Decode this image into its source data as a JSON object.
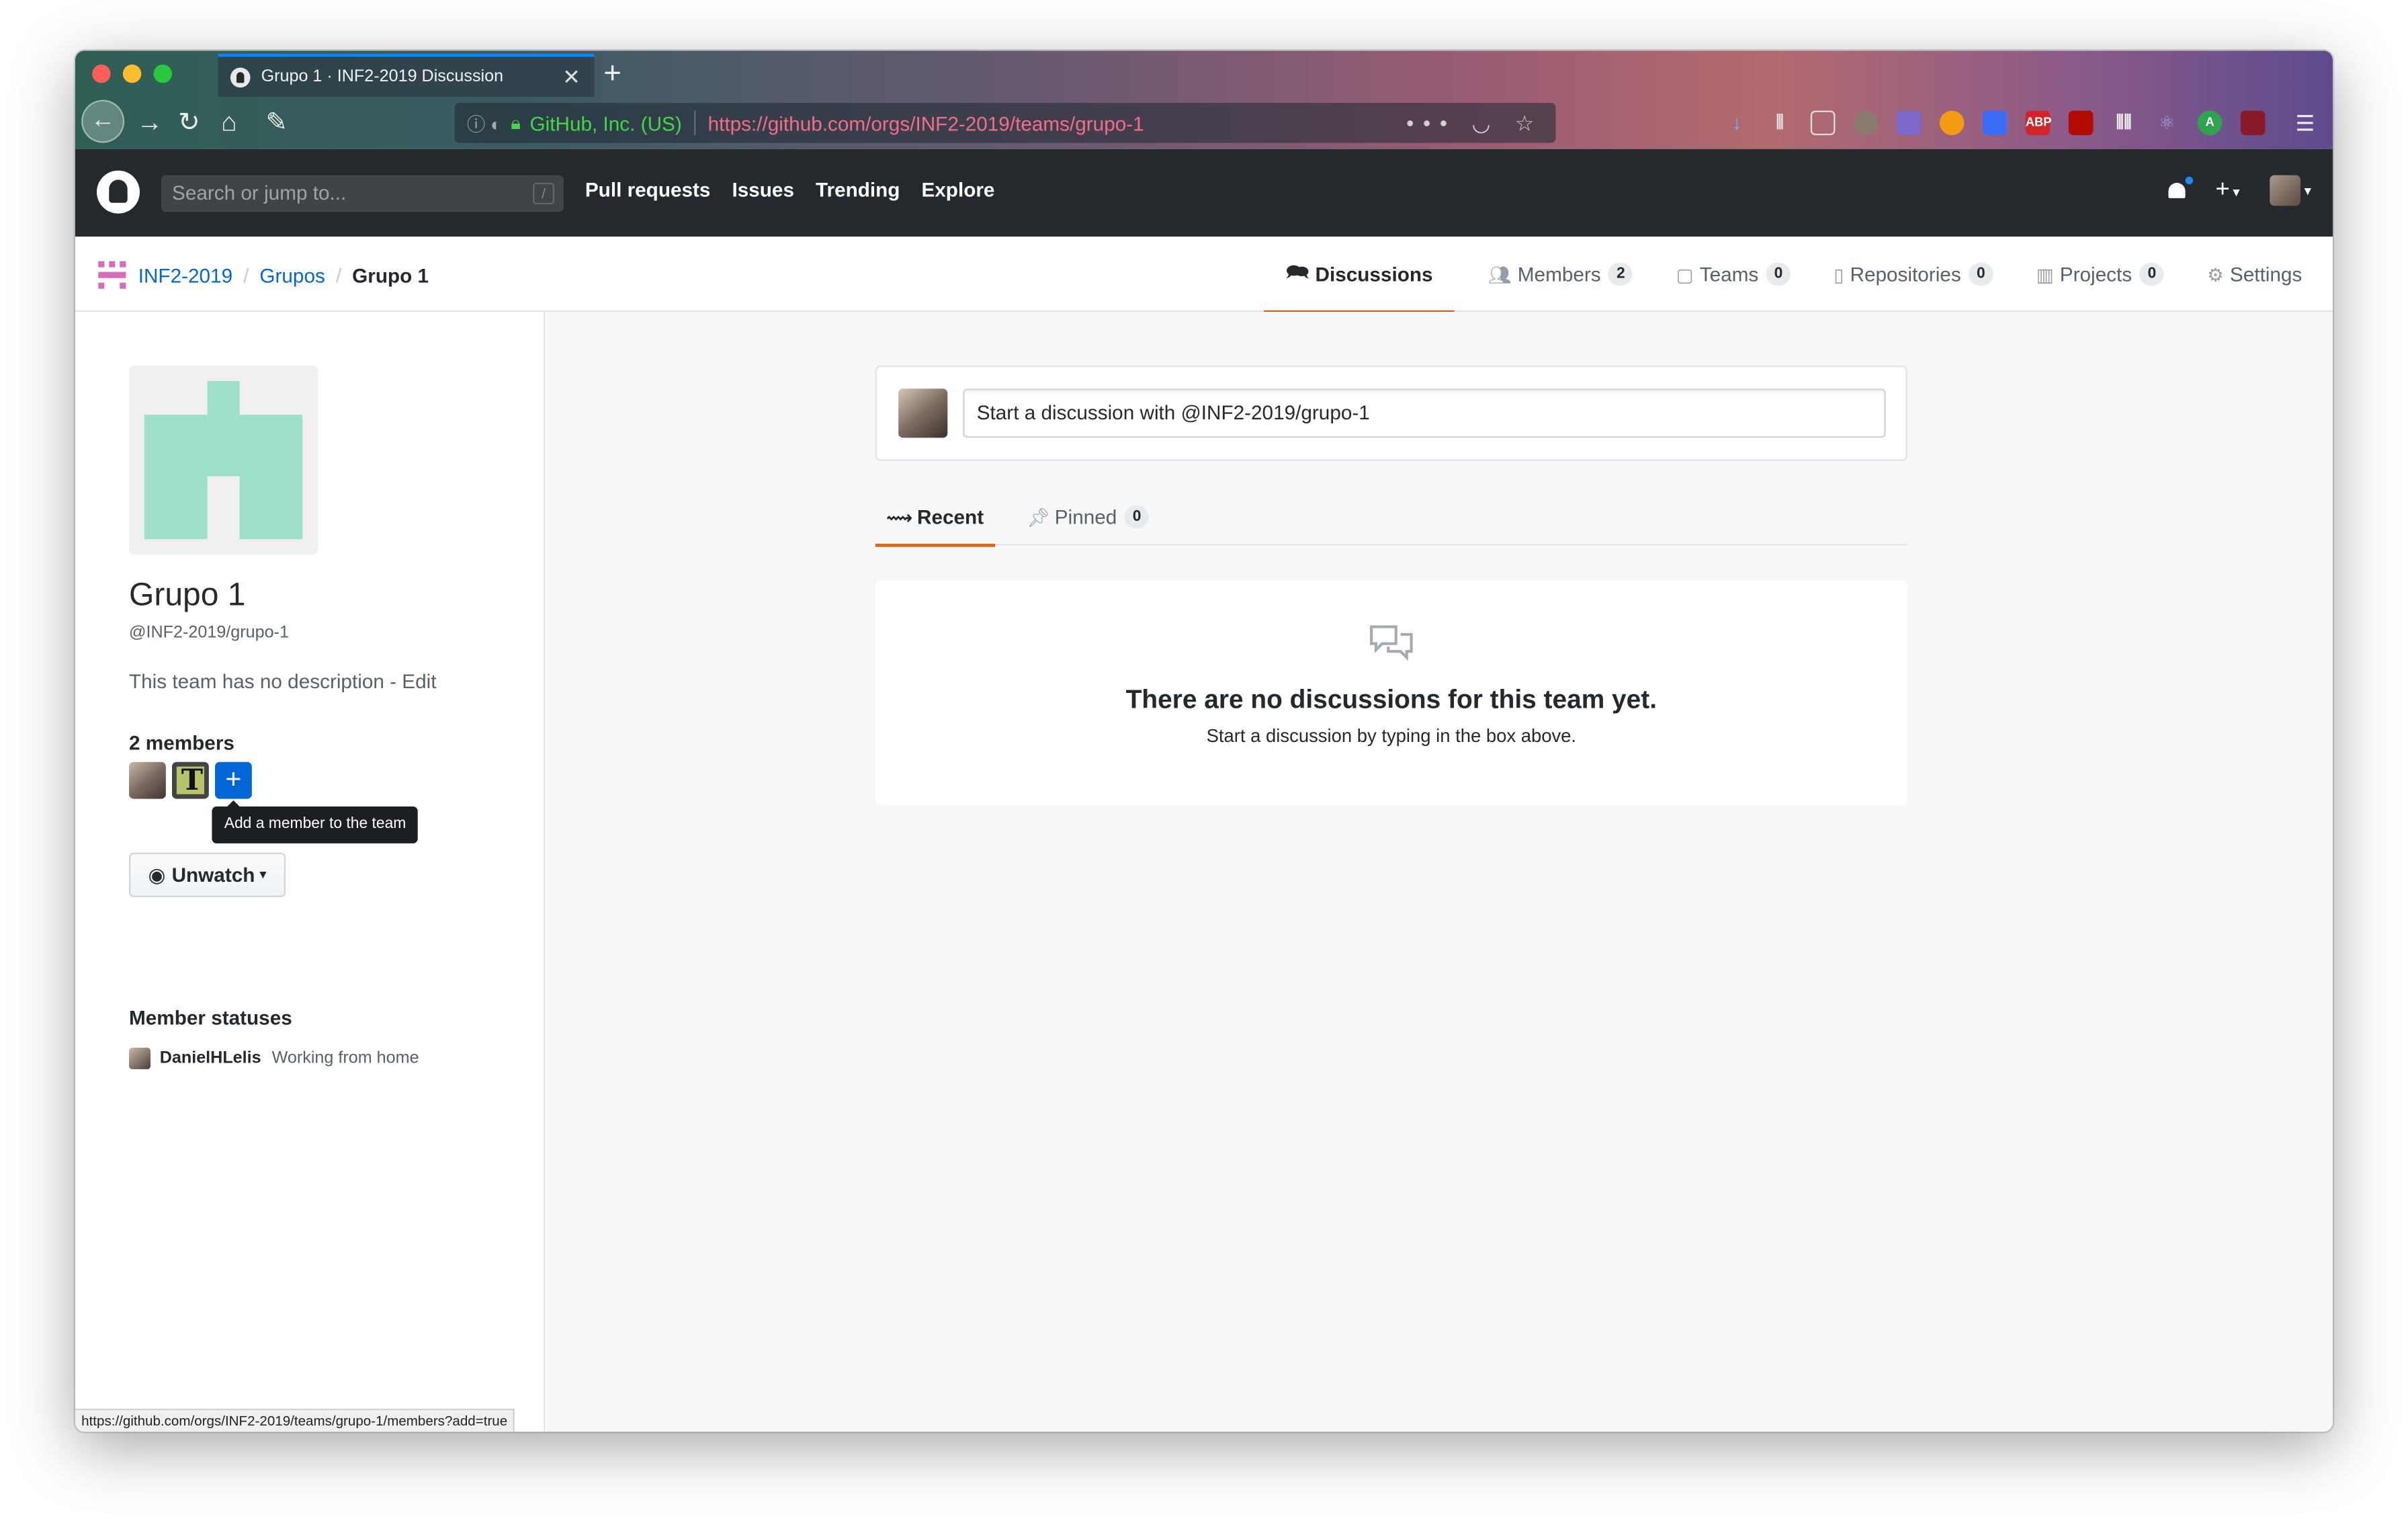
{
  "browser": {
    "tab_title": "Grupo 1 · INF2-2019 Discussion",
    "identity": "GitHub, Inc. (US)",
    "url": "https://github.com/orgs/INF2-2019/teams/grupo-1",
    "page_actions": "•••",
    "status_url": "https://github.com/orgs/INF2-2019/teams/grupo-1/members?add=true"
  },
  "github_header": {
    "search_placeholder": "Search or jump to...",
    "search_hotkey": "/",
    "nav": [
      "Pull requests",
      "Issues",
      "Trending",
      "Explore"
    ]
  },
  "breadcrumb": {
    "org": "INF2-2019",
    "parent": "Grupos",
    "current": "Grupo 1",
    "separator": "/"
  },
  "team_tabs": [
    {
      "label": "Discussions",
      "icon": "comment-discussion-icon",
      "count": null,
      "selected": true
    },
    {
      "label": "Members",
      "icon": "people-icon",
      "count": "2"
    },
    {
      "label": "Teams",
      "icon": "jersey-icon",
      "count": "0"
    },
    {
      "label": "Repositories",
      "icon": "repo-icon",
      "count": "0"
    },
    {
      "label": "Projects",
      "icon": "project-icon",
      "count": "0"
    },
    {
      "label": "Settings",
      "icon": "gear-icon",
      "count": null
    }
  ],
  "sidebar": {
    "team_name": "Grupo 1",
    "team_slug": "@INF2-2019/grupo-1",
    "description": "This team has no description - Edit",
    "members_count": "2 members",
    "add_member_tooltip": "Add a member to the team",
    "unwatch_label": "Unwatch",
    "statuses_heading": "Member statuses",
    "status": {
      "user": "DanielHLelis",
      "message": "Working from home"
    }
  },
  "main": {
    "composer_placeholder": "Start a discussion with @INF2-2019/grupo-1",
    "tabs": [
      {
        "label": "Recent",
        "icon": "pulse-icon",
        "selected": true
      },
      {
        "label": "Pinned",
        "icon": "pin-icon",
        "count": "0"
      }
    ],
    "blankslate_title": "There are no discussions for this team yet.",
    "blankslate_sub": "Start a discussion by typing in the box above."
  },
  "colors": {
    "accent_orange": "#e36209",
    "link_blue": "#0366d6",
    "header_bg": "#24292e",
    "team_avatar": "#9fe0cb",
    "org_avatar": "#d56db9"
  }
}
